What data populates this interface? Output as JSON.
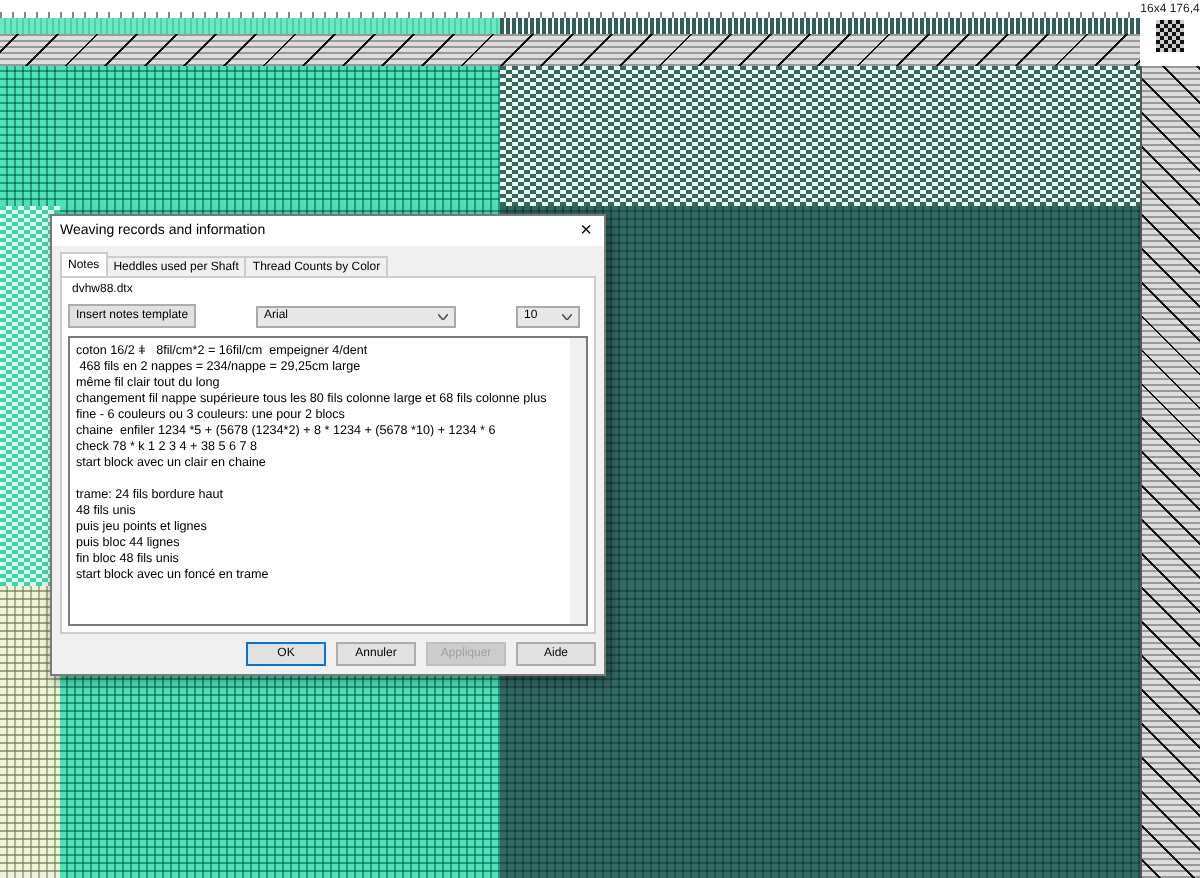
{
  "status_label": "16x4 176,4",
  "dialog": {
    "title": "Weaving records and information",
    "close": "×",
    "tabs": [
      {
        "label": "Notes",
        "selected": true
      },
      {
        "label": "Heddles used per Shaft",
        "selected": false
      },
      {
        "label": "Thread Counts by Color",
        "selected": false
      }
    ],
    "filename": "dvhw88.dtx",
    "template_button": "Insert notes template",
    "font": {
      "value": "Arial"
    },
    "size": {
      "value": "10"
    },
    "notes": [
      [
        "coton 16/2 ǂ   8fil/cm*2 = 16fil/cm  empeigner 4/dent",
        " 468 fils en 2 nappes = 234/nappe = 29,25cm large",
        "même fil clair tout du long",
        "changement fil nappe supérieure tous les 80 fils colonne large et 68 fils colonne plus fine - 6 couleurs ou 3 couleurs: une pour 2 blocs",
        "chaine  enfiler 1234 *5 + (5678 (1234*2) + 8 * 1234 + (5678 *10) + 1234 * 6",
        "check 78 * k 1 2 3 4 + 38 5 6 7 8",
        "start block avec un clair en chaine"
      ],
      [
        "trame: 24 fils bordure haut",
        "48 fils unis",
        "puis jeu points et lignes",
        "puis bloc 44 lignes",
        "fin bloc 48 fils unis",
        "start block avec un foncé en trame"
      ]
    ],
    "buttons": [
      {
        "label": "OK",
        "disabled": false,
        "default": true
      },
      {
        "label": "Annuler",
        "disabled": false,
        "default": false
      },
      {
        "label": "Appliquer",
        "disabled": true,
        "default": false
      },
      {
        "label": "Aide",
        "disabled": false,
        "default": false
      }
    ]
  }
}
